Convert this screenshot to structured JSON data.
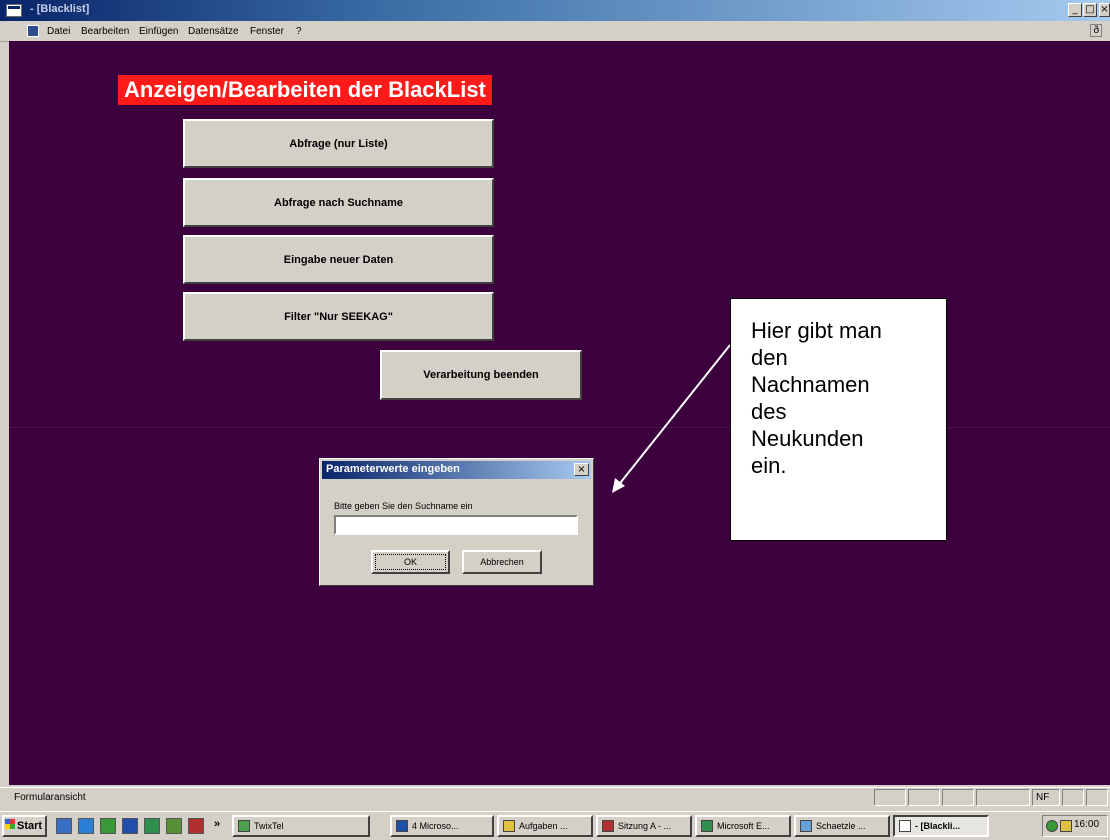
{
  "window": {
    "title": "- [Blacklist]",
    "minimize_glyph": "_",
    "maximize_glyph": "□",
    "close_glyph": "×",
    "title_bar_color": "#0a246a"
  },
  "menu": {
    "items": [
      "Datei",
      "Bearbeiten",
      "Einfügen",
      "Datensätze",
      "Fenster",
      "?"
    ],
    "restore_glyph": "ð"
  },
  "form": {
    "background_color": "#3c003f",
    "title": "Anzeigen/Bearbeiten der BlackList",
    "title_color": "#ff1a1a",
    "buttons": [
      "Abfrage (nur Liste)",
      "Abfrage nach Suchname",
      "Eingabe neuer Daten",
      "Filter \"Nur SEEKAG\"",
      "Verarbeitung beenden"
    ]
  },
  "dialog": {
    "title": "Parameterwerte eingeben",
    "close_glyph": "×",
    "prompt": "Bitte geben Sie den Suchname ein",
    "input_value": "",
    "ok_label": "OK",
    "cancel_label": "Abbrechen"
  },
  "callout": {
    "lines": [
      "Hier gibt man",
      "den",
      "Nachnamen",
      "des",
      "Neukunden",
      "ein."
    ]
  },
  "statusbar": {
    "text": "Formularansicht",
    "indicator": "NF"
  },
  "taskbar": {
    "start_label": "Start",
    "overflow_glyph": "»",
    "quick_launch": [
      "internet-explorer-icon",
      "outlook-icon",
      "word-icon",
      "excel-icon",
      "desktop-icon",
      "access-icon"
    ],
    "tasks": [
      "TwixTel",
      "4 Microso...",
      "Aufgaben ...",
      "Sitzung A - ...",
      "Microsoft E...",
      "Schaetzle ...",
      "- [Blackli..."
    ],
    "active_task_index": 6,
    "clock": "16:00"
  }
}
